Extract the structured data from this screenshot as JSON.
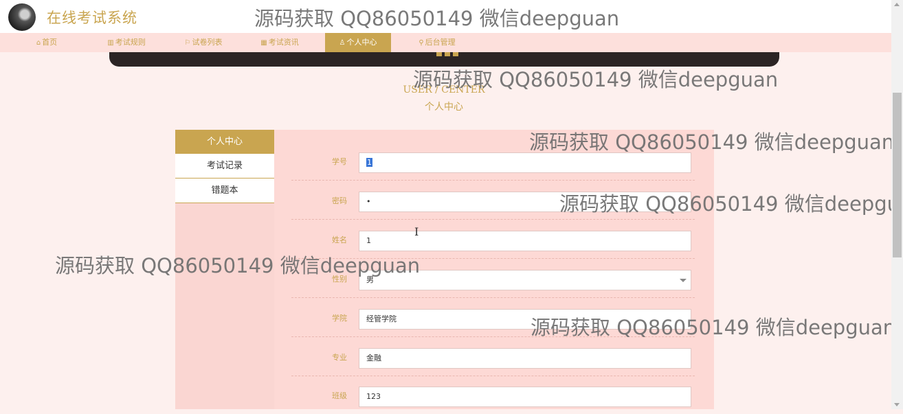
{
  "site": {
    "title": "在线考试系统"
  },
  "nav": [
    {
      "label": "首页",
      "icon": "home-icon",
      "glyph": "⌂"
    },
    {
      "label": "考试规则",
      "icon": "book-icon",
      "glyph": "▥"
    },
    {
      "label": "试卷列表",
      "icon": "flag-icon",
      "glyph": "⚐"
    },
    {
      "label": "考试资讯",
      "icon": "grid-icon",
      "glyph": "▦"
    },
    {
      "label": "个人中心",
      "icon": "user-icon",
      "glyph": "♙"
    },
    {
      "label": "后台管理",
      "icon": "link-icon",
      "glyph": "⚲"
    }
  ],
  "active_nav": "个人中心",
  "section": {
    "en": "USER / CENTER",
    "cn": "个人中心"
  },
  "side_menu": [
    {
      "label": "个人中心"
    },
    {
      "label": "考试记录"
    },
    {
      "label": "错题本"
    }
  ],
  "form": [
    {
      "label": "学号",
      "value": "1"
    },
    {
      "label": "密码",
      "value": "•"
    },
    {
      "label": "姓名",
      "value": "1"
    },
    {
      "label": "性别",
      "value": "男"
    },
    {
      "label": "学院",
      "value": "经管学院"
    },
    {
      "label": "专业",
      "value": "金融"
    },
    {
      "label": "班级",
      "value": "123"
    }
  ],
  "watermark": "源码获取 QQ86050149 微信deepguan",
  "colors": {
    "accent": "#c9a550",
    "nav_bg": "#fde0dc",
    "panel_bg": "#fdd9d5",
    "page_bg": "#fdf0ee"
  }
}
